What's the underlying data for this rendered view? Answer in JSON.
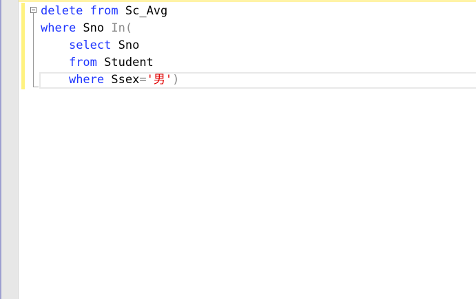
{
  "editor": {
    "lines": [
      {
        "tokens": [
          {
            "text": "delete",
            "type": "kw"
          },
          {
            "text": " ",
            "type": "plain"
          },
          {
            "text": "from",
            "type": "kw"
          },
          {
            "text": " Sc_Avg",
            "type": "plain"
          }
        ]
      },
      {
        "tokens": [
          {
            "text": "where",
            "type": "kw"
          },
          {
            "text": " Sno ",
            "type": "plain"
          },
          {
            "text": "In(",
            "type": "op"
          }
        ]
      },
      {
        "tokens": [
          {
            "text": "    ",
            "type": "plain"
          },
          {
            "text": "select",
            "type": "kw"
          },
          {
            "text": " Sno",
            "type": "plain"
          }
        ]
      },
      {
        "tokens": [
          {
            "text": "    ",
            "type": "plain"
          },
          {
            "text": "from",
            "type": "kw"
          },
          {
            "text": " Student",
            "type": "plain"
          }
        ]
      },
      {
        "tokens": [
          {
            "text": "    ",
            "type": "plain"
          },
          {
            "text": "where",
            "type": "kw"
          },
          {
            "text": " Ssex",
            "type": "plain"
          },
          {
            "text": "=",
            "type": "op"
          },
          {
            "text": "'男'",
            "type": "str"
          },
          {
            "text": ")",
            "type": "op"
          }
        ]
      }
    ]
  },
  "colors": {
    "keyword": "#1e35ff",
    "operator": "#8a8a8a",
    "string": "#e00000",
    "gutter": "#e7e7e7",
    "change_bar": "#fff27f"
  },
  "icons": {
    "fold": "fold-toggle-icon"
  }
}
